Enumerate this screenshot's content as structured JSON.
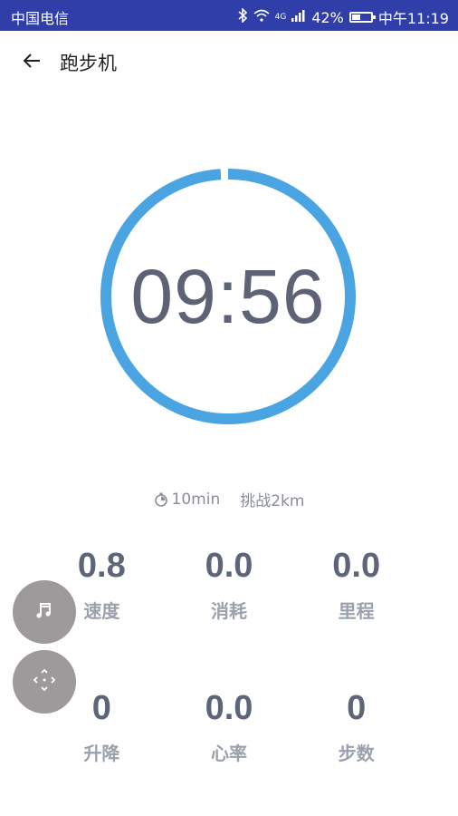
{
  "status_bar": {
    "carrier": "中国电信",
    "network": "4G",
    "battery_percent": "42%",
    "time": "中午11:19"
  },
  "app_bar": {
    "title": "跑步机"
  },
  "timer": {
    "display": "09:56",
    "progress_fraction": 0.99
  },
  "info": {
    "duration": "10min",
    "challenge": "挑战2km"
  },
  "stats": [
    {
      "value": "0.8",
      "label": "速度"
    },
    {
      "value": "0.0",
      "label": "消耗"
    },
    {
      "value": "0.0",
      "label": "里程"
    },
    {
      "value": "0",
      "label": "升降"
    },
    {
      "value": "0.0",
      "label": "心率"
    },
    {
      "value": "0",
      "label": "步数"
    }
  ],
  "colors": {
    "status_bar": "#2f3ea8",
    "ring": "#4aa4e2",
    "value_text": "#5d6578",
    "label_text": "#9aa0ad",
    "fab": "#9e9a9b"
  }
}
